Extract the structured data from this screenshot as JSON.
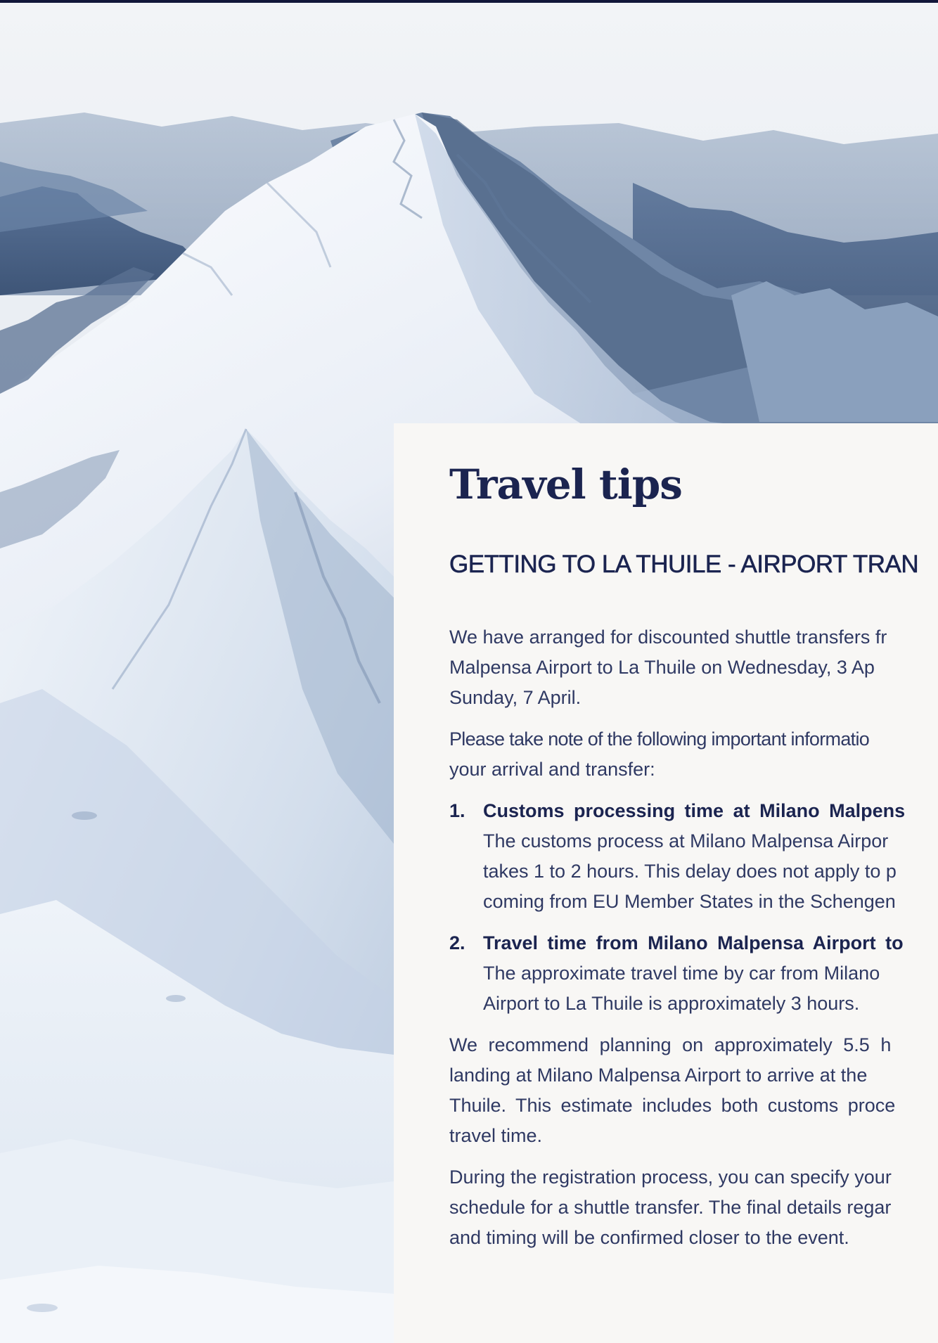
{
  "travel_tips": {
    "title": "Travel tips",
    "subheading": "GETTING TO LA THUILE - AIRPORT TRAN",
    "intro": [
      "We have arranged for discounted shuttle transfers fr",
      "Malpensa Airport to La Thuile on Wednesday, 3 Ap",
      "Sunday, 7 April."
    ],
    "note": [
      "Please take note of the following important informatio",
      "your arrival and transfer:"
    ],
    "items": [
      {
        "number": "1.",
        "heading": "Customs processing time at Milano Malpens",
        "body": [
          "The customs process at Milano Malpensa Airpor",
          "takes 1 to 2 hours. This delay does not apply to p",
          "coming from EU Member States in the Schengen"
        ]
      },
      {
        "number": "2.",
        "heading": "Travel time from Milano Malpensa Airport to",
        "body": [
          "The approximate travel time by car from Milano",
          "Airport to La Thuile is approximately 3 hours."
        ]
      }
    ],
    "recommendation": [
      "We recommend planning on approximately 5.5 h",
      "landing at Milano Malpensa Airport to arrive at the",
      "Thuile. This estimate includes both customs proce",
      "travel time."
    ],
    "registration": [
      "During the registration process, you can specify your",
      "schedule for a shuttle transfer. The final details regar",
      "and timing will be confirmed closer to the event."
    ]
  },
  "colors": {
    "top_bar": "#12173a",
    "panel_background": "#f8f7f5",
    "heading_text": "#1b2450",
    "body_text": "#2f3963",
    "sky": "#eef1f5",
    "snow": "#f4f7fb",
    "snow_shadow": "#aebfd6",
    "distant_range": "#5a7497"
  },
  "hero_image": {
    "icon": "snowy-mountain-landscape-image"
  }
}
